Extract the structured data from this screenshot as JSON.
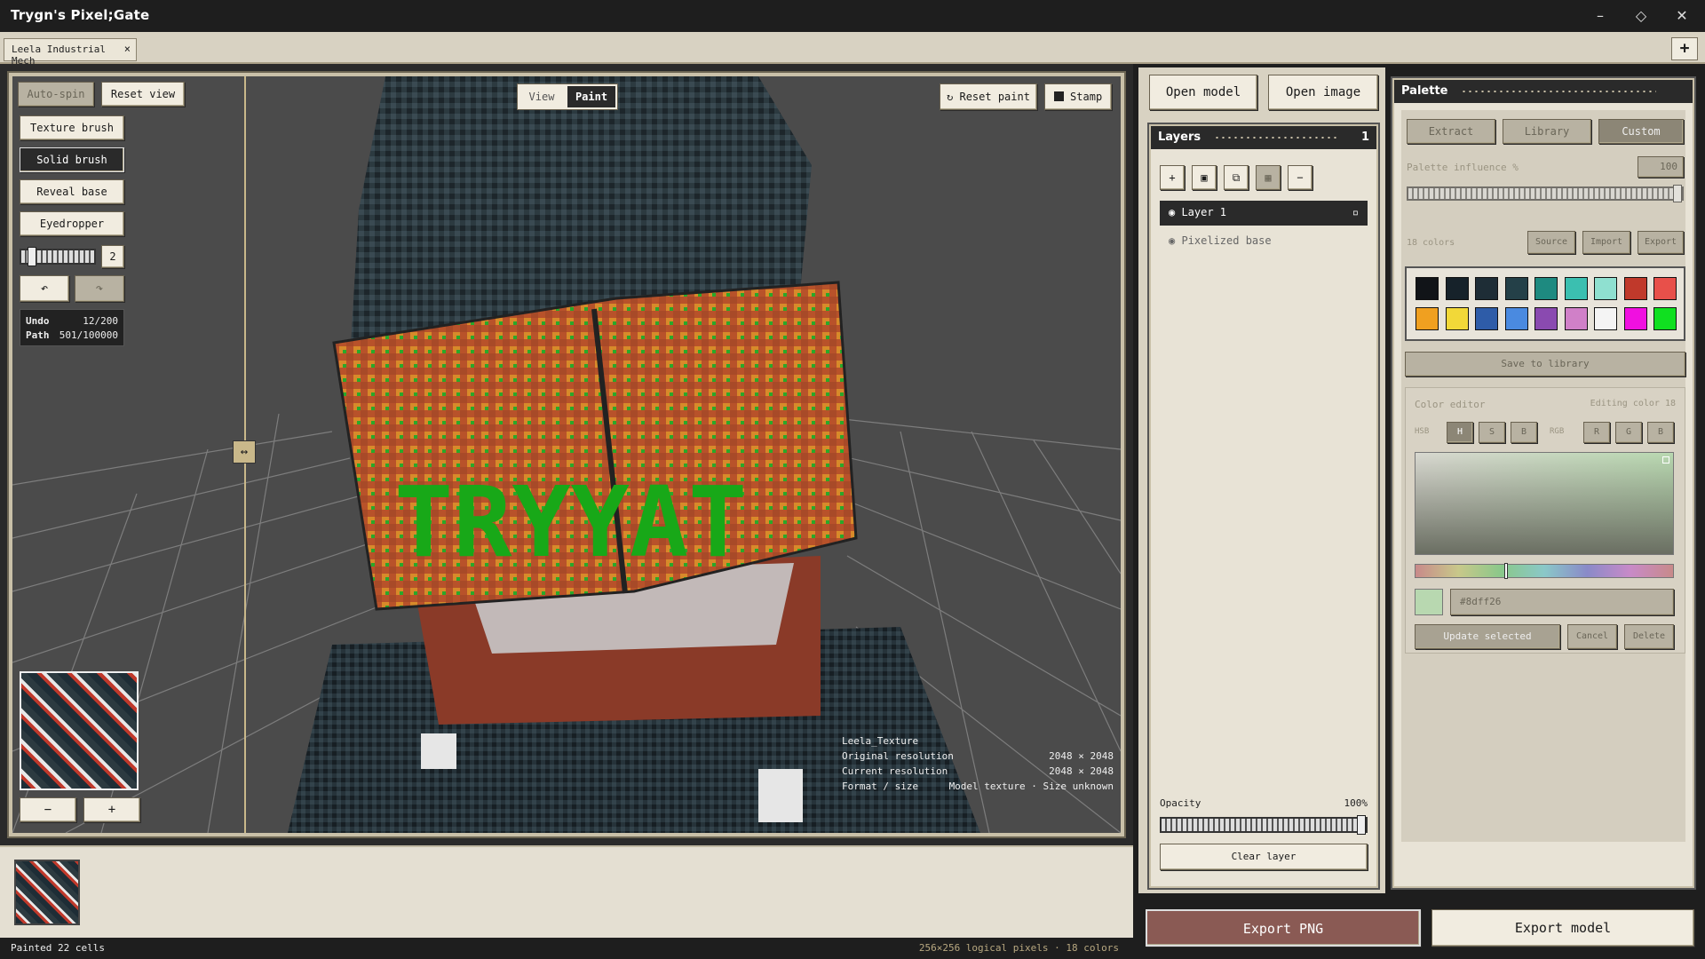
{
  "app": {
    "title": "Trygn's Pixel;Gate",
    "window_controls": [
      "–",
      "◇",
      "✕"
    ]
  },
  "tabs": {
    "active": "Leela Industrial Mech",
    "close": "×",
    "add": "+"
  },
  "viewport": {
    "auto_spin": "Auto-spin",
    "reset_view": "Reset view",
    "mode_view": "View",
    "mode_paint": "Paint",
    "reset_paint": "Reset paint",
    "stamp": "Stamp",
    "tools": {
      "texture_brush": "Texture brush",
      "solid_brush": "Solid brush",
      "reveal_base": "Reveal base",
      "eyedropper": "Eyedropper"
    },
    "brush_size": "2",
    "brush_size_level": 0.1,
    "undo_icon": "↶",
    "redo_icon": "↷",
    "undo_label": "Undo",
    "undo_value": "12/200",
    "path_label": "Path",
    "path_value": "501/100000",
    "zoom_out": "−",
    "zoom_in": "+",
    "texture_info": {
      "name": "Leela_Texture",
      "original_label": "Original resolution",
      "original_value": "2048 × 2048",
      "current_label": "Current resolution",
      "current_value": "2048 × 2048",
      "format_label": "Format / size",
      "format_value": "Model texture · Size unknown"
    },
    "model_text": "TRYYAT"
  },
  "status": {
    "left": "Painted 22 cells",
    "right": "256×256 logical pixels · 18 colors"
  },
  "top_buttons": {
    "open_model": "Open model",
    "open_image": "Open image"
  },
  "layers": {
    "title": "Layers",
    "count": "1",
    "tool_icons": [
      "+",
      "▣",
      "⧉",
      "▦",
      "−"
    ],
    "items": [
      {
        "name": "Layer 1",
        "active": true
      },
      {
        "name": "Pixelized base",
        "active": false
      }
    ],
    "opacity_label": "Opacity",
    "opacity_value": "100%",
    "opacity_level": 1.0,
    "clear_layer": "Clear layer"
  },
  "palette": {
    "title": "Palette",
    "tabs": [
      "Extract",
      "Library",
      "Custom"
    ],
    "active_tab": "Custom",
    "influence_label": "Palette influence %",
    "influence_value": "100",
    "influence_level": 1.0,
    "colors_count": "18 colors",
    "source": "Source",
    "import": "Import",
    "export": "Export",
    "swatches": [
      "#111418",
      "#16222a",
      "#1e2d36",
      "#244048",
      "#1e8a80",
      "#3bbfb0",
      "#8fe0d0",
      "#c0392b",
      "#e8504a",
      "#f0a020",
      "#f2d838",
      "#2e5ca8",
      "#4a8ae0",
      "#8a4ab0",
      "#d080c8",
      "#f4f4f4",
      "#f010e0",
      "#10e020"
    ],
    "save_to_library": "Save to library",
    "editor_label": "Color editor",
    "editing_label": "Editing color 18",
    "hsb_label": "HSB",
    "rgb_label": "RGB",
    "channels_hsb": [
      "H",
      "S",
      "B"
    ],
    "channels_rgb": [
      "R",
      "G",
      "B"
    ],
    "hex_value": "#8dff26",
    "update_selected": "Update selected",
    "cancel": "Cancel",
    "delete": "Delete"
  },
  "export": {
    "png": "Export PNG",
    "model": "Export model"
  }
}
